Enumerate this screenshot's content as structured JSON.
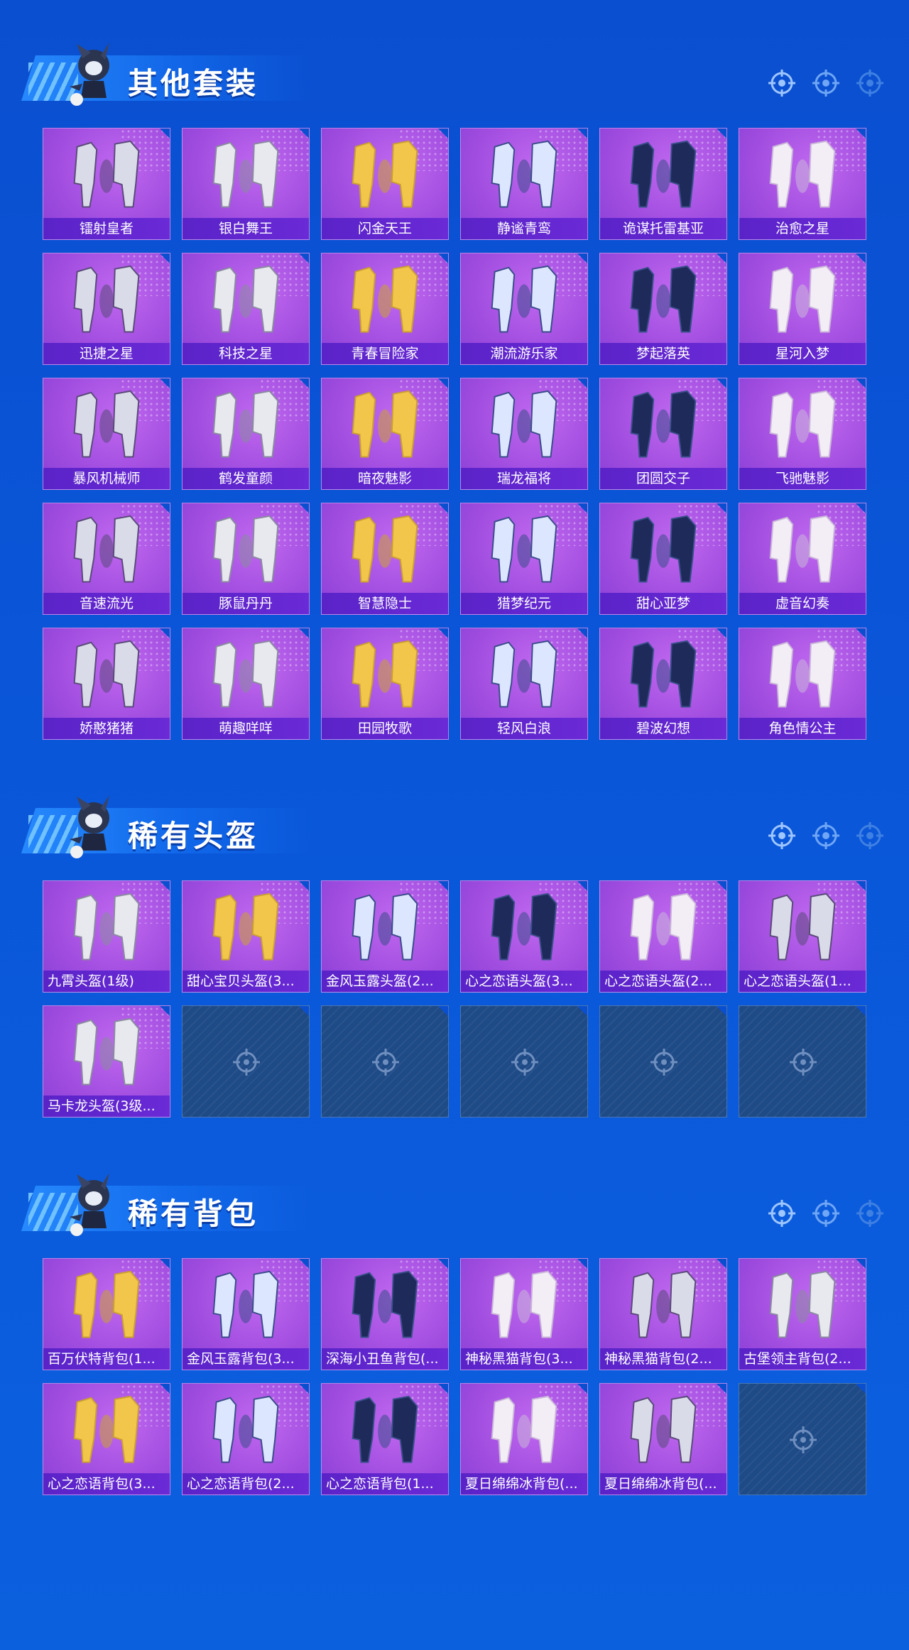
{
  "sections": [
    {
      "title": "其他套装",
      "items": [
        "镭射皇者",
        "银白舞王",
        "闪金天王",
        "静谧青鸾",
        "诡谋托雷基亚",
        "治愈之星",
        "迅捷之星",
        "科技之星",
        "青春冒险家",
        "潮流游乐家",
        "梦起落英",
        "星河入梦",
        "暴风机械师",
        "鹤发童颜",
        "暗夜魅影",
        "瑞龙福将",
        "团圆交子",
        "飞驰魅影",
        "音速流光",
        "豚鼠丹丹",
        "智慧隐士",
        "猎梦纪元",
        "甜心亚梦",
        "虚音幻奏",
        "娇憨猪猪",
        "萌趣咩咩",
        "田园牧歌",
        "轻风白浪",
        "碧波幻想",
        "角色情公主"
      ]
    },
    {
      "title": "稀有头盔",
      "items": [
        "九霄头盔(1级)",
        "甜心宝贝头盔(3...",
        "金风玉露头盔(2...",
        "心之恋语头盔(3...",
        "心之恋语头盔(2...",
        "心之恋语头盔(1...",
        "马卡龙头盔(3级..."
      ]
    },
    {
      "title": "稀有背包",
      "items": [
        "百万伏特背包(1...",
        "金风玉露背包(3...",
        "深海小丑鱼背包(...",
        "神秘黑猫背包(3...",
        "神秘黑猫背包(2...",
        "古堡领主背包(2...",
        "心之恋语背包(3...",
        "心之恋语背包(2...",
        "心之恋语背包(1...",
        "夏日绵绵冰背包(...",
        "夏日绵绵冰背包(..."
      ]
    }
  ],
  "colors": {
    "background": "#0a55d8",
    "card": "#a24ee0",
    "label_bar": "#5a23c8",
    "empty_slot": "#1e4a86"
  },
  "icons": {
    "header_decoration": "crosshair-icon",
    "empty_slot": "crosshair-icon"
  }
}
